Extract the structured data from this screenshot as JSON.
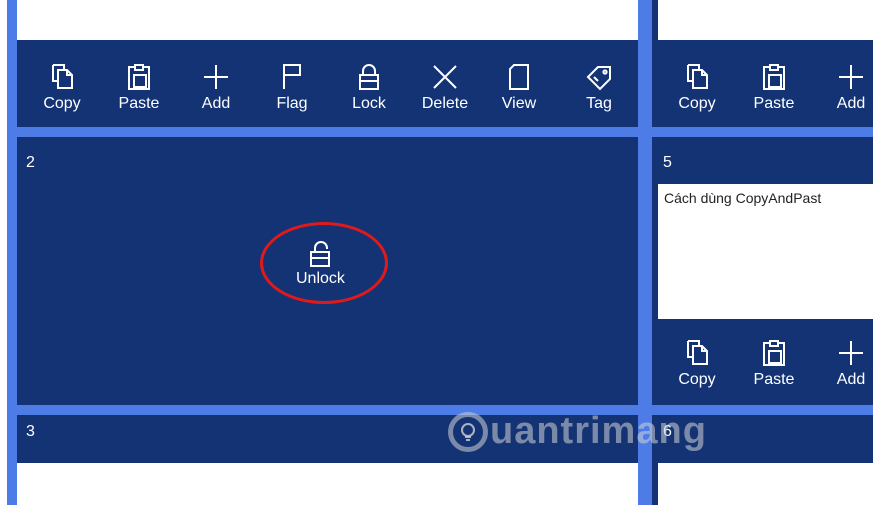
{
  "toolbar_labels": {
    "copy": "Copy",
    "paste": "Paste",
    "add": "Add",
    "flag": "Flag",
    "lock": "Lock",
    "delete": "Delete",
    "view": "View",
    "tag": "Tag"
  },
  "notes": {
    "note2": {
      "number": "2",
      "action_label": "Unlock"
    },
    "note3": {
      "number": "3"
    },
    "note5": {
      "number": "5",
      "text": "Cách dùng CopyAndPast"
    },
    "note6": {
      "number": "6"
    }
  },
  "watermark": {
    "text": "uantrimang"
  },
  "colors": {
    "panel": "#133375",
    "frame": "#4d7ce6",
    "highlight": "#e01a1a"
  },
  "icons": [
    "copy-icon",
    "paste-icon",
    "add-icon",
    "flag-icon",
    "lock-icon",
    "delete-icon",
    "view-icon",
    "tag-icon",
    "unlock-icon"
  ]
}
